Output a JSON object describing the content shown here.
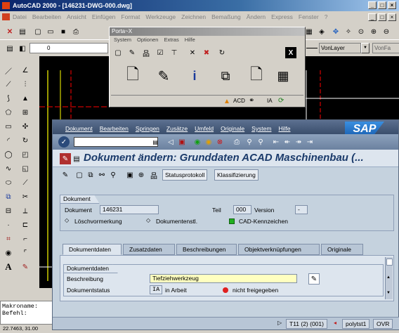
{
  "acad": {
    "title": "AutoCAD 2000 - [146231-DWG-000.dwg]",
    "menu": [
      "Datei",
      "Bearbeiten",
      "Ansicht",
      "Einfügen",
      "Format",
      "Werkzeuge",
      "Zeichnen",
      "Bemaßung",
      "Ändern",
      "Express",
      "Fenster",
      "?"
    ],
    "layer_value": "0",
    "linetype_1": "VonLayer",
    "linetype_2": "VonFa",
    "command_lines": [
      "Makroname:",
      "Befehl:"
    ],
    "coords": "22.7463, 31.00"
  },
  "portax": {
    "title": "Porta~X",
    "menu": [
      "System",
      "Optionen",
      "Extras",
      "Hilfe"
    ],
    "status_acd": "ACD",
    "status_ia": "IA"
  },
  "sap": {
    "menu": [
      "Dokument",
      "Bearbeiten",
      "Springen",
      "Zusätze",
      "Umfeld",
      "Originale",
      "System",
      "Hilfe"
    ],
    "logo": "SAP",
    "title": "Dokument ändern: Grunddaten  ACAD Maschinenbau (...",
    "apptb": {
      "statusprotokoll": "Statusprotokoll",
      "klassifizierung": "Klassifizierung"
    },
    "dokument_box": {
      "title": "Dokument",
      "dokument_label": "Dokument",
      "dokument_value": "146231",
      "teil_label": "Teil",
      "teil_value": "000",
      "version_label": "Version",
      "version_value": "-",
      "loeschvormerkung": "Löschvormerkung",
      "dokumentenstl": "Dokumentenstl.",
      "cad_kennzeichen": "CAD-Kennzeichen"
    },
    "tabs": [
      "Dokumentdaten",
      "Zusatzdaten",
      "Beschreibungen",
      "Objektverknüpfungen",
      "Originale"
    ],
    "dokdaten": {
      "title": "Dokumentdaten",
      "beschreibung_label": "Beschreibung",
      "beschreibung_value": "Tiefziehwerkzeug",
      "status_label": "Dokumentstatus",
      "status_code": "IA",
      "status_text": "in Arbeit",
      "status_flag": "nicht freigegeben"
    },
    "status": {
      "session": "T11 (2) (001)",
      "server": "polytst1",
      "mode": "OVR"
    }
  },
  "colors": {
    "sap_title": "#1a3a6a",
    "drawing_bg": "#000000",
    "red_flag": "#e02020",
    "green_flag": "#20b020"
  }
}
